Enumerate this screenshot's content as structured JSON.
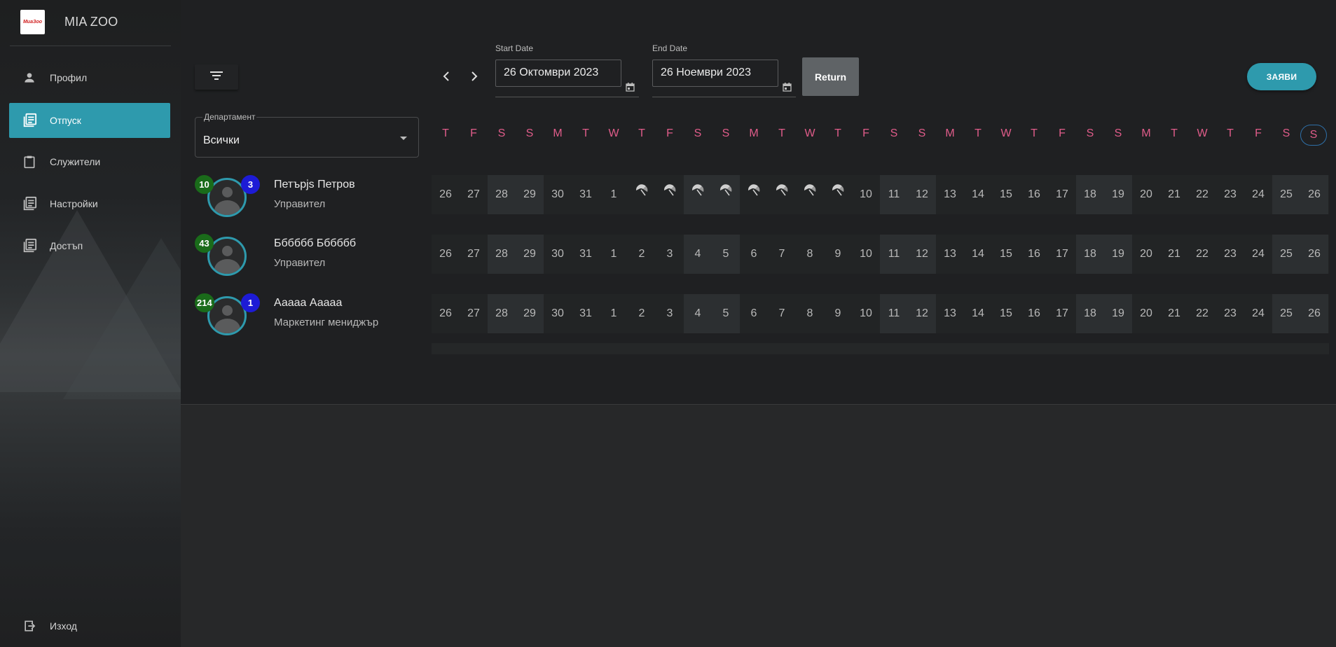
{
  "app": {
    "name": "MIA ZOO",
    "logo_text": "МиаЗоо"
  },
  "nav": {
    "items": [
      {
        "label": "Профил",
        "icon": "person-icon",
        "active": false
      },
      {
        "label": "Отпуск",
        "icon": "list-icon",
        "active": true
      },
      {
        "label": "Служители",
        "icon": "clipboard-icon",
        "active": false
      },
      {
        "label": "Настройки",
        "icon": "list-icon",
        "active": false
      },
      {
        "label": "Достъп",
        "icon": "list-icon",
        "active": false
      }
    ],
    "logout": {
      "label": "Изход",
      "icon": "logout-icon"
    }
  },
  "filters": {
    "department": {
      "label": "Департамент",
      "value": "Всички"
    },
    "start_date": {
      "label": "Start Date",
      "value": "26 Октомври 2023"
    },
    "end_date": {
      "label": "End Date",
      "value": "26 Ноември 2023"
    },
    "return_label": "Return",
    "apply_label": "ЗАЯВИ"
  },
  "calendar": {
    "weekdays": [
      "T",
      "F",
      "S",
      "S",
      "M",
      "T",
      "W",
      "T",
      "F",
      "S",
      "S",
      "M",
      "T",
      "W",
      "T",
      "F",
      "S",
      "S",
      "M",
      "T",
      "W",
      "T",
      "F",
      "S",
      "S",
      "M",
      "T",
      "W",
      "T",
      "F",
      "S",
      "S"
    ],
    "dates": [
      "26",
      "27",
      "28",
      "29",
      "30",
      "31",
      "1",
      "2",
      "3",
      "4",
      "5",
      "6",
      "7",
      "8",
      "9",
      "10",
      "11",
      "12",
      "13",
      "14",
      "15",
      "16",
      "17",
      "18",
      "19",
      "20",
      "21",
      "22",
      "23",
      "24",
      "25",
      "26"
    ],
    "weekend_indices": [
      2,
      3,
      9,
      10,
      16,
      17,
      23,
      24,
      30,
      31
    ],
    "today_index": 31,
    "vacation_icon": "umbrella-icon"
  },
  "employees": [
    {
      "name": "Петърjs Петров",
      "role": "Управител",
      "badge_green": "10",
      "badge_blue": "3",
      "vacation_indices": [
        7,
        8,
        9,
        10,
        11,
        12,
        13,
        14
      ]
    },
    {
      "name": "Бббббб Бббббб",
      "role": "Управител",
      "badge_green": "43",
      "badge_blue": "",
      "vacation_indices": []
    },
    {
      "name": "Ааааа Ааааа",
      "role": "Маркетинг мениджър",
      "badge_green": "214",
      "badge_blue": "1",
      "vacation_indices": []
    }
  ],
  "colors": {
    "accent": "#2e9aad",
    "weekday_text": "#e05c8a",
    "badge_green": "#1a6b1a",
    "badge_blue": "#1d1bd6"
  }
}
